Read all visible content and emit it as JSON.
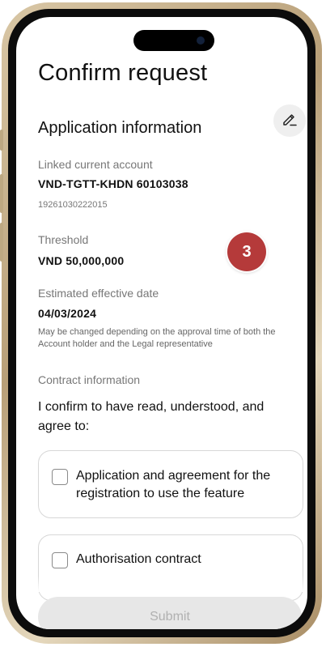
{
  "page": {
    "title": "Confirm request",
    "section_title": "Application information"
  },
  "fields": {
    "linked_account_label": "Linked current account",
    "linked_account_name": "VND-TGTT-KHDN 60103038",
    "linked_account_number": "19261030222015",
    "threshold_label": "Threshold",
    "threshold_value": "VND 50,000,000",
    "effective_date_label": "Estimated effective date",
    "effective_date_value": "04/03/2024",
    "effective_date_note": "May be changed depending on the approval time of both the Account holder and the Legal representative"
  },
  "contract": {
    "label": "Contract information",
    "statement": "I confirm to have read, understood, and agree to:",
    "items": [
      {
        "label": "Application and agreement for the registration to use the feature",
        "checked": false
      },
      {
        "label": "Authorisation contract",
        "checked": false
      }
    ]
  },
  "actions": {
    "submit_label": "Submit",
    "edit_icon": "pencil-icon"
  },
  "annotation": {
    "step_number": "3",
    "color": "#b53a3a"
  }
}
